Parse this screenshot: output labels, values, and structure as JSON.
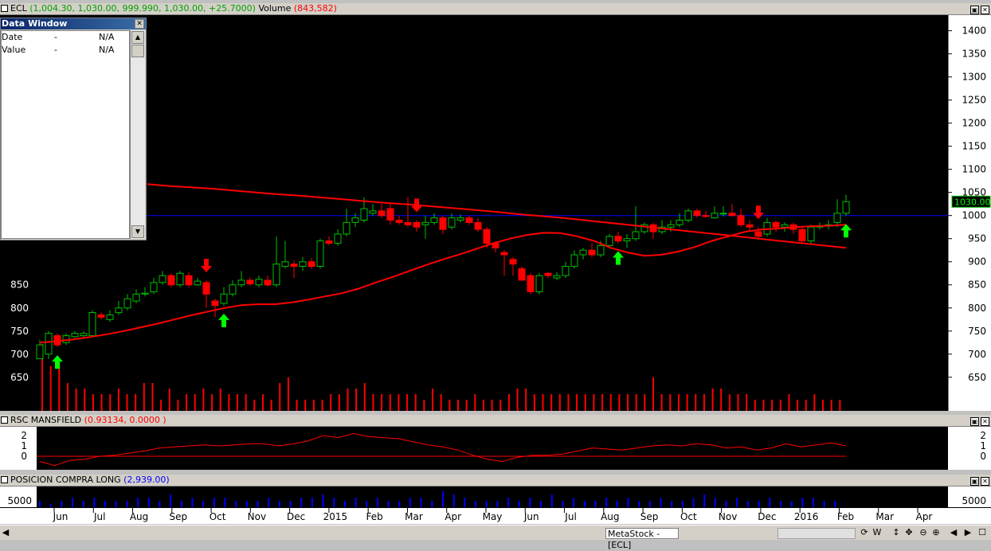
{
  "chart_header": {
    "symbol": "ECL",
    "ohlc": "(1,004.30, 1,030.00, 999.990, 1,030.00, +25.7000)",
    "volume_label": "Volume",
    "volume_value": "(843,582)"
  },
  "price_tag": "1030.000",
  "price_axis": [
    "1400",
    "1350",
    "1300",
    "1250",
    "1200",
    "1150",
    "1100",
    "1050",
    "1000",
    "950",
    "900",
    "850",
    "800",
    "750",
    "700",
    "650"
  ],
  "price_axis_left": [
    "850",
    "800",
    "750",
    "700",
    "650"
  ],
  "indicator1": {
    "name": "RSC MANSFIELD",
    "values": "(0.93134, 0.0000 )",
    "axis": [
      "2",
      "1",
      "0"
    ]
  },
  "indicator2": {
    "name": "POSICION COMPRA LONG",
    "values": "(2,939.00)",
    "axis": [
      "5000"
    ]
  },
  "time_axis": [
    "Jun",
    "Jul",
    "Aug",
    "Sep",
    "Oct",
    "Nov",
    "Dec",
    "2015",
    "Feb",
    "Mar",
    "Apr",
    "May",
    "Jun",
    "Jul",
    "Aug",
    "Sep",
    "Oct",
    "Nov",
    "Dec",
    "2016",
    "Feb",
    "Mar",
    "Apr"
  ],
  "data_window": {
    "title": "Data Window",
    "rows": [
      {
        "label": "Date",
        "dash": "-",
        "value": "N/A"
      },
      {
        "label": "Value",
        "dash": "-",
        "value": "N/A"
      }
    ]
  },
  "statusbar": {
    "tab_label": "MetaStock - [ECL]",
    "toolbar_w": "W"
  },
  "colors": {
    "up": "#ffffff",
    "up_border": "#00c000",
    "down": "#ff0000",
    "ma": "#ff0000",
    "hline": "#0000ff",
    "buy_arrow": "#00ff00",
    "sell_arrow": "#ff0000"
  },
  "chart_data": {
    "type": "candlestick",
    "price_range": [
      610,
      1420
    ],
    "horizontal_line": 1000,
    "candles": [
      {
        "o": 690,
        "c": 720,
        "h": 730,
        "l": 690
      },
      {
        "o": 700,
        "c": 745,
        "h": 750,
        "l": 690
      },
      {
        "o": 740,
        "c": 720,
        "h": 745,
        "l": 715
      },
      {
        "o": 725,
        "c": 740,
        "h": 745,
        "l": 720
      },
      {
        "o": 738,
        "c": 745,
        "h": 750,
        "l": 735
      },
      {
        "o": 740,
        "c": 745,
        "h": 750,
        "l": 736
      },
      {
        "o": 740,
        "c": 790,
        "h": 795,
        "l": 738
      },
      {
        "o": 785,
        "c": 780,
        "h": 790,
        "l": 775
      },
      {
        "o": 775,
        "c": 785,
        "h": 795,
        "l": 770
      },
      {
        "o": 790,
        "c": 800,
        "h": 815,
        "l": 785
      },
      {
        "o": 800,
        "c": 820,
        "h": 830,
        "l": 795
      },
      {
        "o": 815,
        "c": 830,
        "h": 840,
        "l": 810
      },
      {
        "o": 830,
        "c": 832,
        "h": 845,
        "l": 825
      },
      {
        "o": 835,
        "c": 855,
        "h": 865,
        "l": 830
      },
      {
        "o": 855,
        "c": 870,
        "h": 880,
        "l": 850
      },
      {
        "o": 870,
        "c": 850,
        "h": 875,
        "l": 845
      },
      {
        "o": 850,
        "c": 875,
        "h": 880,
        "l": 845
      },
      {
        "o": 870,
        "c": 850,
        "h": 878,
        "l": 845
      },
      {
        "o": 850,
        "c": 858,
        "h": 865,
        "l": 848
      },
      {
        "o": 855,
        "c": 830,
        "h": 860,
        "l": 800
      },
      {
        "o": 815,
        "c": 805,
        "h": 820,
        "l": 780
      },
      {
        "o": 810,
        "c": 830,
        "h": 845,
        "l": 805
      },
      {
        "o": 830,
        "c": 850,
        "h": 860,
        "l": 825
      },
      {
        "o": 850,
        "c": 860,
        "h": 880,
        "l": 845
      },
      {
        "o": 860,
        "c": 852,
        "h": 866,
        "l": 848
      },
      {
        "o": 850,
        "c": 862,
        "h": 870,
        "l": 845
      },
      {
        "o": 860,
        "c": 850,
        "h": 870,
        "l": 846
      },
      {
        "o": 850,
        "c": 895,
        "h": 955,
        "l": 845
      },
      {
        "o": 890,
        "c": 900,
        "h": 945,
        "l": 885
      },
      {
        "o": 895,
        "c": 890,
        "h": 903,
        "l": 865
      },
      {
        "o": 890,
        "c": 900,
        "h": 910,
        "l": 880
      },
      {
        "o": 900,
        "c": 890,
        "h": 908,
        "l": 885
      },
      {
        "o": 890,
        "c": 945,
        "h": 950,
        "l": 885
      },
      {
        "o": 945,
        "c": 940,
        "h": 955,
        "l": 935
      },
      {
        "o": 940,
        "c": 960,
        "h": 970,
        "l": 935
      },
      {
        "o": 960,
        "c": 985,
        "h": 1015,
        "l": 955
      },
      {
        "o": 985,
        "c": 995,
        "h": 1005,
        "l": 975
      },
      {
        "o": 990,
        "c": 1015,
        "h": 1040,
        "l": 985
      },
      {
        "o": 1005,
        "c": 1010,
        "h": 1025,
        "l": 1000
      },
      {
        "o": 1010,
        "c": 1000,
        "h": 1025,
        "l": 995
      },
      {
        "o": 1015,
        "c": 990,
        "h": 1025,
        "l": 980
      },
      {
        "o": 990,
        "c": 985,
        "h": 1000,
        "l": 980
      },
      {
        "o": 985,
        "c": 980,
        "h": 1040,
        "l": 975
      },
      {
        "o": 985,
        "c": 975,
        "h": 990,
        "l": 965
      },
      {
        "o": 980,
        "c": 985,
        "h": 1000,
        "l": 950
      },
      {
        "o": 985,
        "c": 995,
        "h": 1005,
        "l": 980
      },
      {
        "o": 995,
        "c": 970,
        "h": 1000,
        "l": 960
      },
      {
        "o": 975,
        "c": 995,
        "h": 1005,
        "l": 970
      },
      {
        "o": 990,
        "c": 995,
        "h": 1002,
        "l": 985
      },
      {
        "o": 995,
        "c": 985,
        "h": 1000,
        "l": 980
      },
      {
        "o": 985,
        "c": 970,
        "h": 995,
        "l": 965
      },
      {
        "o": 970,
        "c": 940,
        "h": 975,
        "l": 930
      },
      {
        "o": 940,
        "c": 930,
        "h": 945,
        "l": 920
      },
      {
        "o": 920,
        "c": 915,
        "h": 925,
        "l": 870
      },
      {
        "o": 905,
        "c": 895,
        "h": 910,
        "l": 870
      },
      {
        "o": 885,
        "c": 860,
        "h": 890,
        "l": 860
      },
      {
        "o": 870,
        "c": 835,
        "h": 875,
        "l": 830
      },
      {
        "o": 835,
        "c": 870,
        "h": 875,
        "l": 830
      },
      {
        "o": 875,
        "c": 870,
        "h": 878,
        "l": 865
      },
      {
        "o": 865,
        "c": 870,
        "h": 878,
        "l": 860
      },
      {
        "o": 870,
        "c": 890,
        "h": 900,
        "l": 865
      },
      {
        "o": 890,
        "c": 915,
        "h": 925,
        "l": 885
      },
      {
        "o": 915,
        "c": 925,
        "h": 930,
        "l": 905
      },
      {
        "o": 925,
        "c": 915,
        "h": 940,
        "l": 910
      },
      {
        "o": 915,
        "c": 935,
        "h": 945,
        "l": 910
      },
      {
        "o": 935,
        "c": 955,
        "h": 960,
        "l": 930
      },
      {
        "o": 955,
        "c": 945,
        "h": 965,
        "l": 940
      },
      {
        "o": 945,
        "c": 950,
        "h": 960,
        "l": 930
      },
      {
        "o": 950,
        "c": 965,
        "h": 1020,
        "l": 945
      },
      {
        "o": 965,
        "c": 980,
        "h": 985,
        "l": 960
      },
      {
        "o": 980,
        "c": 965,
        "h": 985,
        "l": 950
      },
      {
        "o": 965,
        "c": 975,
        "h": 990,
        "l": 960
      },
      {
        "o": 975,
        "c": 980,
        "h": 990,
        "l": 965
      },
      {
        "o": 980,
        "c": 990,
        "h": 1005,
        "l": 975
      },
      {
        "o": 990,
        "c": 1010,
        "h": 1015,
        "l": 985
      },
      {
        "o": 1010,
        "c": 1000,
        "h": 1015,
        "l": 995
      },
      {
        "o": 1000,
        "c": 998,
        "h": 1010,
        "l": 995
      },
      {
        "o": 995,
        "c": 1005,
        "h": 1020,
        "l": 993
      },
      {
        "o": 1005,
        "c": 1005,
        "h": 1020,
        "l": 998
      },
      {
        "o": 1005,
        "c": 1000,
        "h": 1025,
        "l": 998
      },
      {
        "o": 1000,
        "c": 980,
        "h": 1015,
        "l": 975
      },
      {
        "o": 980,
        "c": 975,
        "h": 990,
        "l": 965
      },
      {
        "o": 965,
        "c": 955,
        "h": 975,
        "l": 950
      },
      {
        "o": 960,
        "c": 985,
        "h": 995,
        "l": 955
      },
      {
        "o": 985,
        "c": 975,
        "h": 990,
        "l": 965
      },
      {
        "o": 975,
        "c": 980,
        "h": 985,
        "l": 965
      },
      {
        "o": 980,
        "c": 970,
        "h": 985,
        "l": 960
      },
      {
        "o": 970,
        "c": 945,
        "h": 975,
        "l": 940
      },
      {
        "o": 945,
        "c": 975,
        "h": 980,
        "l": 940
      },
      {
        "o": 975,
        "c": 978,
        "h": 985,
        "l": 970
      },
      {
        "o": 978,
        "c": 980,
        "h": 990,
        "l": 970
      },
      {
        "o": 985,
        "c": 1005,
        "h": 1035,
        "l": 975
      },
      {
        "o": 1005,
        "c": 1030,
        "h": 1045,
        "l": 999
      }
    ],
    "ma_short": [
      725,
      728,
      732,
      737,
      743,
      750,
      758,
      766,
      775,
      784,
      792,
      800,
      806,
      808,
      808,
      812,
      818,
      825,
      832,
      842,
      855,
      867,
      880,
      893,
      905,
      916,
      928,
      940,
      950,
      958,
      963,
      962,
      955,
      945,
      930,
      920,
      913,
      915,
      922,
      932,
      945,
      955,
      965,
      970,
      972,
      975,
      977,
      978,
      980
    ],
    "ma_long": [
      1068,
      1064,
      1061,
      1058,
      1054,
      1050,
      1046,
      1043,
      1039,
      1035,
      1031,
      1027,
      1024,
      1020,
      1016,
      1012,
      1008,
      1003,
      999,
      995,
      990,
      985,
      980,
      975,
      970,
      965,
      960,
      955,
      950,
      945,
      940,
      935,
      930
    ],
    "buy_arrows": [
      2,
      21,
      66,
      92
    ],
    "sell_arrows": [
      19,
      43,
      82
    ],
    "volume": [
      12,
      8,
      9,
      5,
      4,
      4,
      3,
      3,
      3,
      4,
      3,
      3,
      5,
      5,
      2,
      4,
      2,
      3,
      3,
      4,
      3,
      4,
      3,
      3,
      3,
      2,
      3,
      2,
      5,
      6,
      2,
      2,
      2,
      2,
      3,
      3,
      4,
      4,
      5,
      3,
      3,
      3,
      3,
      3,
      3,
      2,
      4,
      3,
      2,
      2,
      2,
      3,
      2,
      2,
      2,
      3,
      4,
      4,
      3,
      3,
      3,
      3,
      3,
      3,
      3,
      3,
      3,
      3,
      3,
      3,
      3,
      3,
      6,
      3,
      3,
      3,
      3,
      3,
      3,
      4,
      4,
      3,
      3,
      3,
      2,
      2,
      2,
      2,
      3,
      2,
      2,
      3,
      2,
      2,
      2
    ],
    "rsc_mansfield": [
      -0.5,
      -0.9,
      -0.4,
      -0.3,
      0,
      0.1,
      0.3,
      0.5,
      0.8,
      0.9,
      1.0,
      1.1,
      1.0,
      1.1,
      1.2,
      1.2,
      1.0,
      1.2,
      1.5,
      2.0,
      1.8,
      2.2,
      1.9,
      1.8,
      1.7,
      1.4,
      1.1,
      0.9,
      0.6,
      0.1,
      -0.3,
      -0.5,
      -0.1,
      0.1,
      0.1,
      0.2,
      0.5,
      0.8,
      0.7,
      0.6,
      0.8,
      1.0,
      1.1,
      1.0,
      1.2,
      1.1,
      0.8,
      0.9,
      0.6,
      0.8,
      1.2,
      0.9,
      1.1,
      1.3,
      1.0
    ],
    "position_long": [
      2,
      1,
      2,
      3,
      2,
      3,
      2,
      2,
      2,
      3,
      3,
      2,
      4,
      2,
      3,
      2,
      3,
      3,
      2,
      2,
      2,
      3,
      2,
      2,
      3,
      3,
      4,
      3,
      2,
      3,
      2,
      3,
      2,
      2,
      3,
      3,
      2,
      5,
      4,
      3,
      2,
      2,
      2,
      3,
      2,
      3,
      2,
      4,
      2,
      3,
      2,
      2,
      3,
      2,
      3,
      2,
      2,
      3,
      2,
      2,
      3,
      4,
      3,
      2,
      3,
      2,
      2,
      3,
      2,
      2,
      3,
      3,
      2,
      2
    ]
  }
}
